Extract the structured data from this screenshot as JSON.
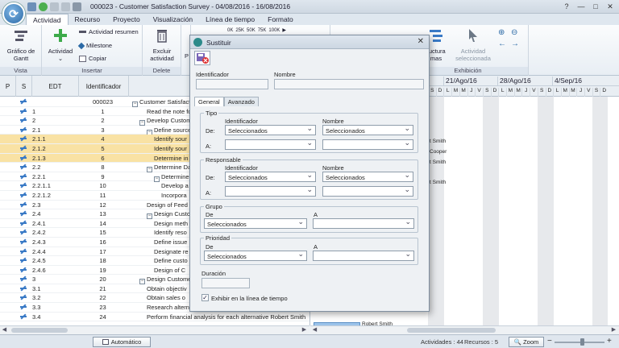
{
  "window": {
    "title": "000023 - Customer Satisfaction Survey  -  04/08/2016 - 16/08/2016",
    "colors": {
      "accent": "#2c6aa6",
      "selected_row": "#f9e2a4",
      "bar": "#9cc3ea"
    }
  },
  "tabs": [
    "Actividad",
    "Recurso",
    "Proyecto",
    "Visualización",
    "Línea de tiempo",
    "Formato"
  ],
  "ribbon": {
    "gantt_label": "Gráfico de Gantt",
    "actividad_label": "Actividad",
    "actividad_resumen": "Actividad resumen",
    "milestone": "Milestone",
    "copiar": "Copiar",
    "excluir_label": "Excluir actividad",
    "p_label": "P",
    "estructura_label": "ructura",
    "estructura_label2": "mas",
    "actividad_seleccionada": "Actividad seleccionada",
    "groups": {
      "vista": "Vista",
      "insertar": "Insertar",
      "delete": "Delete",
      "exhibicion": "Exhibición"
    },
    "zoom_labels": [
      "0K",
      "25K",
      "50K",
      "75K",
      "100K"
    ]
  },
  "grid": {
    "headers": {
      "p": "P",
      "s": "S",
      "edt": "EDT",
      "id": "Identificador"
    },
    "rows": [
      {
        "edt": "",
        "id": "000023",
        "name": "Customer Satisfacti",
        "indent": 0,
        "exp": "−",
        "sel": false
      },
      {
        "edt": "1",
        "id": "1",
        "name": "Read the note fo",
        "indent": 2,
        "exp": "",
        "sel": false
      },
      {
        "edt": "2",
        "id": "2",
        "name": "Develop Custome",
        "indent": 1,
        "exp": "−",
        "sel": false
      },
      {
        "edt": "2.1",
        "id": "3",
        "name": "Define sources",
        "indent": 2,
        "exp": "−",
        "sel": false
      },
      {
        "edt": "2.1.1",
        "id": "4",
        "name": "Identify sour",
        "indent": 3,
        "exp": "",
        "sel": true
      },
      {
        "edt": "2.1.2",
        "id": "5",
        "name": "Identify sour",
        "indent": 3,
        "exp": "",
        "sel": true
      },
      {
        "edt": "2.1.3",
        "id": "6",
        "name": "Determine in",
        "indent": 3,
        "exp": "",
        "sel": true
      },
      {
        "edt": "2.2",
        "id": "8",
        "name": "Determine Dat",
        "indent": 2,
        "exp": "−",
        "sel": false
      },
      {
        "edt": "2.2.1",
        "id": "9",
        "name": "Determine a",
        "indent": 3,
        "exp": "−",
        "sel": false
      },
      {
        "edt": "2.2.1.1",
        "id": "10",
        "name": "Develop a",
        "indent": 4,
        "exp": "",
        "sel": false
      },
      {
        "edt": "2.2.1.2",
        "id": "11",
        "name": "Incorpora",
        "indent": 4,
        "exp": "",
        "sel": false
      },
      {
        "edt": "2.3",
        "id": "12",
        "name": "Design of Feed",
        "indent": 2,
        "exp": "",
        "sel": false
      },
      {
        "edt": "2.4",
        "id": "13",
        "name": "Design Custom",
        "indent": 2,
        "exp": "−",
        "sel": false
      },
      {
        "edt": "2.4.1",
        "id": "14",
        "name": "Design meth",
        "indent": 3,
        "exp": "",
        "sel": false
      },
      {
        "edt": "2.4.2",
        "id": "15",
        "name": "Identify reso",
        "indent": 3,
        "exp": "",
        "sel": false
      },
      {
        "edt": "2.4.3",
        "id": "16",
        "name": "Define issue",
        "indent": 3,
        "exp": "",
        "sel": false
      },
      {
        "edt": "2.4.4",
        "id": "17",
        "name": "Designate re",
        "indent": 3,
        "exp": "",
        "sel": false
      },
      {
        "edt": "2.4.5",
        "id": "18",
        "name": "Define custo",
        "indent": 3,
        "exp": "",
        "sel": false
      },
      {
        "edt": "2.4.6",
        "id": "19",
        "name": "Design of C",
        "indent": 3,
        "exp": "",
        "sel": false
      },
      {
        "edt": "3",
        "id": "20",
        "name": "Design Custome",
        "indent": 1,
        "exp": "−",
        "sel": false
      },
      {
        "edt": "3.1",
        "id": "21",
        "name": "Obtain objectiv",
        "indent": 2,
        "exp": "",
        "sel": false
      },
      {
        "edt": "3.2",
        "id": "22",
        "name": "Obtain sales o",
        "indent": 2,
        "exp": "",
        "sel": false
      },
      {
        "edt": "3.3",
        "id": "23",
        "name": "Research alternatives to measure customer sa Robert Smith",
        "indent": 2,
        "exp": "",
        "sel": false
      },
      {
        "edt": "3.4",
        "id": "24",
        "name": "Perform financial analysis for each alternative  Robert Smith",
        "indent": 2,
        "exp": "",
        "sel": false
      }
    ]
  },
  "gantt": {
    "weeks": [
      "21/Ago/16",
      "28/Ago/16",
      "4/Sep/16"
    ],
    "days": [
      "S",
      "D",
      "L",
      "M",
      "M",
      "J",
      "V",
      "S",
      "D",
      "L",
      "M",
      "M",
      "J",
      "V",
      "S",
      "D",
      "L",
      "M",
      "M",
      "J",
      "V",
      "S",
      "D"
    ],
    "labels": [
      {
        "row": 4,
        "text": "t Smith"
      },
      {
        "row": 5,
        "text": "Cooper"
      },
      {
        "row": 6,
        "text": "t Smith"
      },
      {
        "row": 8,
        "text": "t Smith"
      },
      {
        "row": 22,
        "text": "Robert Smith"
      },
      {
        "row": 23,
        "text": "Robert Smith"
      }
    ]
  },
  "dialog": {
    "title": "Sustituir",
    "identificador_label": "Identificador",
    "nombre_label": "Nombre",
    "tabs": [
      "General",
      "Avanzado"
    ],
    "tipo": {
      "legend": "Tipo",
      "col_id": "Identificador",
      "col_name": "Nombre",
      "de": "De:",
      "a": "A:",
      "de_id": "Seleccionados",
      "de_name": "Seleccionados"
    },
    "responsable": {
      "legend": "Responsable",
      "col_id": "Identificador",
      "col_name": "Nombre",
      "de": "De:",
      "a": "A:",
      "de_id": "Seleccionados",
      "de_name": "Seleccionados"
    },
    "grupo": {
      "legend": "Grupo",
      "de": "De",
      "a": "A",
      "de_value": "Seleccionados"
    },
    "prioridad": {
      "legend": "Prioridad",
      "de": "De",
      "a": "A",
      "de_value": "Seleccionados"
    },
    "duracion_label": "Duración",
    "exhibir_label": "Exhibir en la línea de tiempo",
    "exhibir_checked": "✓"
  },
  "status": {
    "automatico": "Automático",
    "actividades": "Actividades : 44",
    "recursos": "Recursos : 5",
    "zoom": "Zoom"
  }
}
